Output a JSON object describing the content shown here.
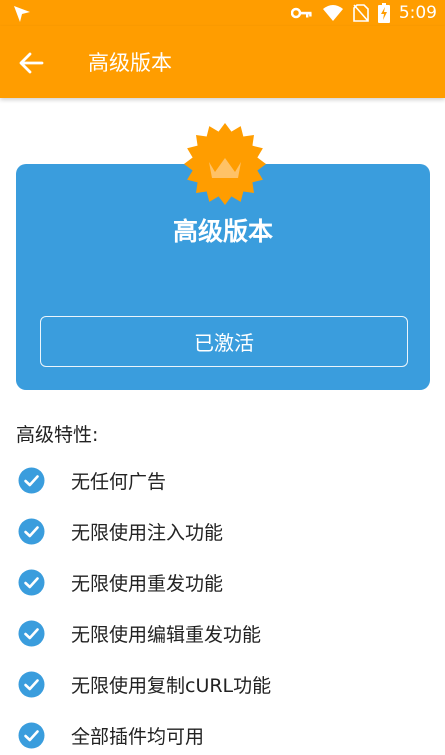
{
  "status_bar": {
    "time": "5:09",
    "icons": [
      "navigation-arrow-icon",
      "vpn-key-icon",
      "wifi-icon",
      "no-sim-icon",
      "battery-charging-icon"
    ]
  },
  "app_bar": {
    "title": "高级版本",
    "back_icon": "arrow-left-icon"
  },
  "premium_card": {
    "badge_icon": "crown-badge-icon",
    "title": "高级版本",
    "button_label": "已激活"
  },
  "features": {
    "heading": "高级特性:",
    "items": [
      {
        "label": "无任何广告"
      },
      {
        "label": "无限使用注入功能"
      },
      {
        "label": "无限使用重发功能"
      },
      {
        "label": "无限使用编辑重发功能"
      },
      {
        "label": "无限使用复制cURL功能"
      },
      {
        "label": "全部插件均可用"
      }
    ]
  },
  "colors": {
    "accent": "#FF9D00",
    "card": "#3A9DDD",
    "check": "#3A9DDD"
  }
}
